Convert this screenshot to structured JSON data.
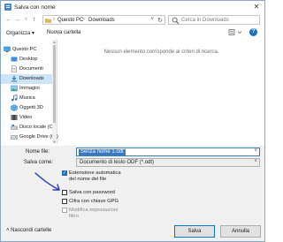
{
  "window": {
    "title": "Salva con nome",
    "close_glyph": "✕"
  },
  "address": {
    "back_glyph": "←",
    "forward_glyph": "→",
    "history_glyph": "˅",
    "up_glyph": "↑",
    "crumb_sep": "›",
    "crumbs": [
      "Questo PC",
      "Downloads"
    ],
    "dropdown_glyph": "˅",
    "refresh_glyph": "↻"
  },
  "search": {
    "placeholder": "Cerca in Downloads"
  },
  "toolbar": {
    "organize_label": "Organizza ▾",
    "new_folder_label": "Nuova cartella",
    "help_glyph": "?"
  },
  "nav_pane": {
    "items": [
      {
        "label": "Questo PC",
        "icon": "pc-icon"
      },
      {
        "label": "Desktop",
        "icon": "desktop-icon"
      },
      {
        "label": "Documenti",
        "icon": "documents-icon"
      },
      {
        "label": "Downloads",
        "icon": "downloads-icon",
        "selected": true
      },
      {
        "label": "Immagini",
        "icon": "pictures-icon"
      },
      {
        "label": "Musica",
        "icon": "music-icon"
      },
      {
        "label": "Oggetti 3D",
        "icon": "objects3d-icon"
      },
      {
        "label": "Video",
        "icon": "video-icon"
      },
      {
        "label": "Disco locale (C:)",
        "icon": "local-disk-icon"
      },
      {
        "label": "Google Drive (G:)",
        "icon": "google-drive-icon"
      }
    ]
  },
  "content": {
    "empty_message": "Nessun elemento corrisponde ai criteri di ricerca."
  },
  "fields": {
    "filename_label": "Nome file:",
    "filename_value": "Senza nome 1.odt",
    "filetype_label": "Salva come:",
    "filetype_value": "Documento di testo ODF (*.odt)",
    "dropdown_glyph": "˅"
  },
  "options": {
    "check_glyph": "✓",
    "auto_extension": {
      "label_line1": "Estensione automatica",
      "label_line2": "del nome del file",
      "checked": true
    },
    "save_password": {
      "label": "Salva con password",
      "checked": false
    },
    "gpg_encrypt": {
      "label": "Cifra con chiave GPG",
      "checked": false
    },
    "edit_filter": {
      "label_line1": "Modifica impostazioni",
      "label_line2": "filtro",
      "checked": false,
      "disabled": true
    }
  },
  "bottom": {
    "hide_folders_label": "˄  Nascondi cartelle",
    "save_label": "Salva",
    "cancel_label": "Annulla"
  },
  "colors": {
    "accent": "#0078d7",
    "selection": "#cce4f7",
    "annotation_arrow": "#2a3fbf"
  }
}
